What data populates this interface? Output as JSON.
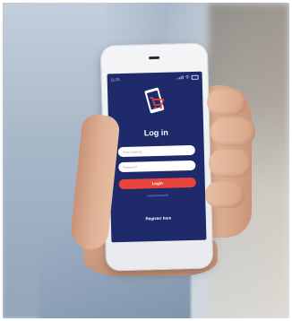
{
  "status_bar": {
    "time": "11:23"
  },
  "login": {
    "title": "Log in",
    "email_placeholder": "Email address",
    "password_placeholder": "Password",
    "login_label": "Login",
    "forgot_label": "Forgot password?",
    "register_label": "Register here"
  },
  "colors": {
    "screen_bg": "#1f2a6b",
    "button": "#e8453c",
    "logo_accent": "#e8453c"
  },
  "icons": [
    "shopping-cart-icon",
    "signal-icon",
    "wifi-icon",
    "battery-icon"
  ]
}
